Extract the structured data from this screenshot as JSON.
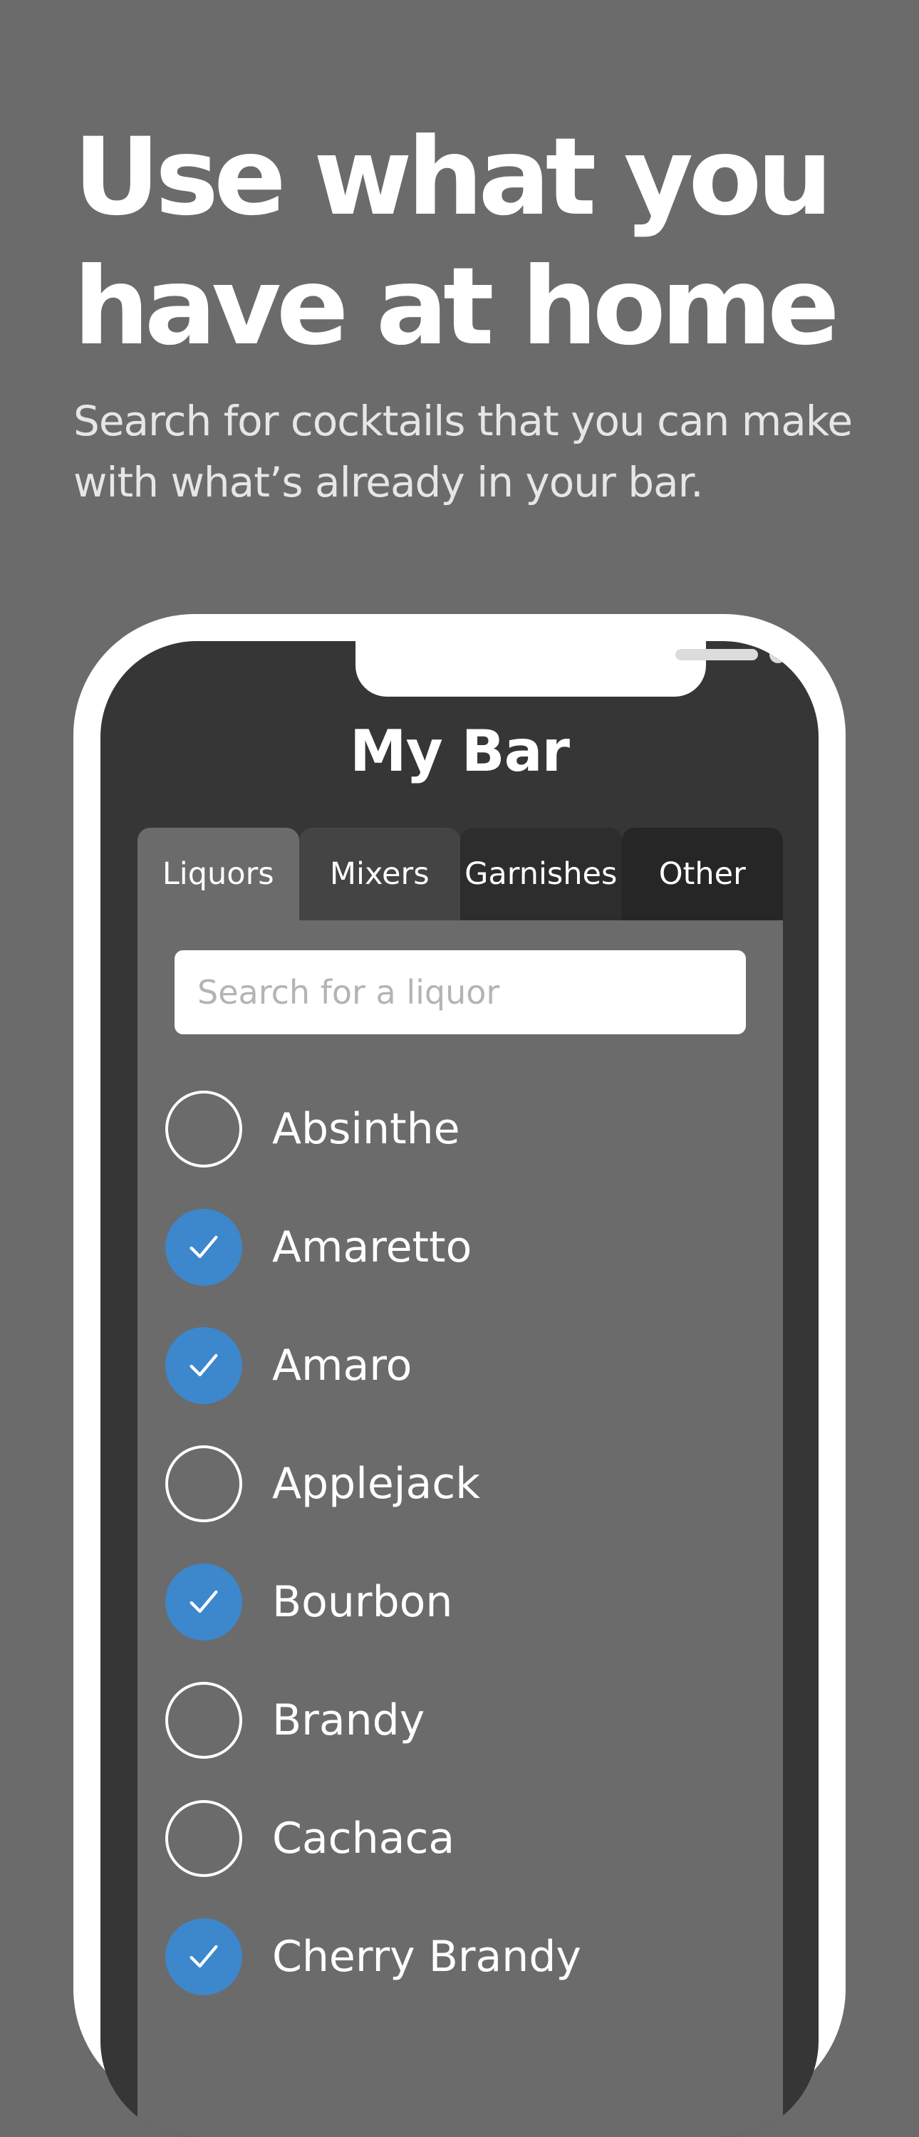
{
  "hero": {
    "headline": "Use what you have at home",
    "subheadline": "Search for cocktails that you can make with what’s already in your bar."
  },
  "app": {
    "title": "My Bar",
    "tabs": [
      {
        "label": "Liquors",
        "active": true
      },
      {
        "label": "Mixers",
        "active": false
      },
      {
        "label": "Garnishes",
        "active": false
      },
      {
        "label": "Other",
        "active": false
      }
    ],
    "search": {
      "placeholder": "Search for a liquor",
      "value": ""
    },
    "items": [
      {
        "label": "Absinthe",
        "checked": false
      },
      {
        "label": "Amaretto",
        "checked": true
      },
      {
        "label": "Amaro",
        "checked": true
      },
      {
        "label": "Applejack",
        "checked": false
      },
      {
        "label": "Bourbon",
        "checked": true
      },
      {
        "label": "Brandy",
        "checked": false
      },
      {
        "label": "Cachaca",
        "checked": false
      },
      {
        "label": "Cherry Brandy",
        "checked": true
      }
    ]
  },
  "colors": {
    "background": "#6b6b6b",
    "screen": "#363636",
    "accent": "#3d87cc",
    "frame": "#ffffff"
  },
  "icons": {
    "checkbox": "checkmark-icon"
  }
}
